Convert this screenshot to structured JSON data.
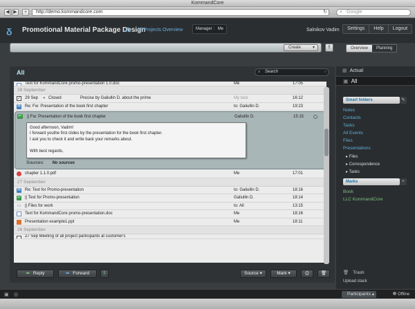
{
  "window": {
    "title": "KommandCore"
  },
  "browser": {
    "back": "◀",
    "forward": "▶",
    "add": "+",
    "url": "http://demo.kommandcore.com",
    "reload": "↻",
    "search_placeholder": "Google"
  },
  "header": {
    "logo": "δ",
    "project_title": "Promotional Material Package Design",
    "all_projects": "All Projects Overview",
    "manager_label": "Manager :",
    "manager_value": "Me",
    "user": "Salnikov Vadim",
    "settings": "Settings",
    "help": "Help",
    "logout": "Logout"
  },
  "command": {
    "create": "Create",
    "overview": "Overview",
    "planning": "Planning"
  },
  "main": {
    "title": "All",
    "search_placeholder": "Search",
    "top_partial": {
      "subject": "Text for KommandCore promo-presentation 1.0.doc",
      "from": "Me",
      "time": "17:05"
    },
    "groups": [
      {
        "date": "28 September",
        "rows": [
          {
            "icon": "✓",
            "kind": "check",
            "date": "29 Sep",
            "status": "Closed",
            "subject": "Precise by Galiullin D. about the prime",
            "from": "My task",
            "from_muted": true,
            "time": "16:12"
          },
          {
            "icon": "✉",
            "kind": "mail",
            "subject": "Re: Fw: Presentation of the book first chapter",
            "from": "to: Galiullin D.",
            "time": "19:23"
          }
        ],
        "expanded": {
          "subject": "|| Fw: Presentation of the book first chapter",
          "from": "Galiullin D.",
          "time": "15:15",
          "body": [
            "Good afternoon, Vadim!",
            "I forward youthe first clides by the presentation for the book first chapter.",
            "I ask you to check it and write back your remarks about.",
            "",
            "With best regards,"
          ],
          "sources_label": "Sources:",
          "sources_value": "No sources"
        },
        "after": [
          {
            "icon": "",
            "kind": "pdf",
            "subject": "chapter 1.1.0.pdf",
            "from": "Me",
            "time": "17:01"
          }
        ]
      },
      {
        "date": "27 September",
        "rows": [
          {
            "icon": "✉",
            "kind": "mail",
            "subject": "Re: Text for Promo-presentation",
            "from": "to: Galiullin D.",
            "time": "18:16"
          },
          {
            "icon": "↩",
            "kind": "reply",
            "subject": "|| Text for Promo-presentation",
            "from": "Galiullin D.",
            "time": "18:14"
          },
          {
            "icon": "▭",
            "kind": "files",
            "subject": "|| Files for work",
            "from": "to: All",
            "time": "13:15"
          },
          {
            "icon": "",
            "kind": "doc",
            "subject": "Text for KommandCore promo-presentation.doc",
            "from": "Me",
            "time": "18:16"
          },
          {
            "icon": "",
            "kind": "ppt",
            "subject": "Presentation example1.ppt",
            "from": "Me",
            "time": "18:11"
          }
        ]
      },
      {
        "date": "26 September",
        "rows": [
          {
            "icon": "",
            "kind": "check",
            "subject": "27 Sep      Meeting of all project participants at customer's",
            "from": "",
            "time": ""
          }
        ]
      }
    ]
  },
  "actions": {
    "reply": "Reply",
    "forward": "Forward",
    "source": "Source",
    "mark": "Mark"
  },
  "sidebar": {
    "actual": "Actual",
    "all": "All",
    "smart_folders": "Smart folders",
    "links": [
      "Notes",
      "Contacts",
      "Tasks",
      "All Events",
      "Files",
      "Presentations"
    ],
    "sublinks": [
      "Files",
      "Correspondence",
      "Tasks"
    ],
    "marks_title": "Marks",
    "marks": [
      "Book",
      "LLC KommandCore"
    ],
    "trash": "Trash",
    "upload_stack": "Upload stack"
  },
  "status": {
    "participants": "Participants",
    "offline": "Offline"
  },
  "colors": {
    "accent_blue": "#5fb0d8",
    "mark_green": "#7cc07c",
    "dark_bg": "#2b2e31"
  }
}
